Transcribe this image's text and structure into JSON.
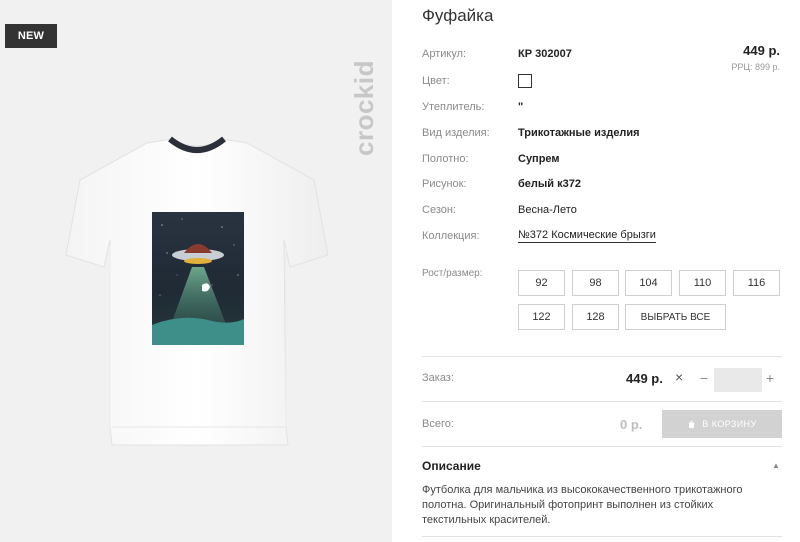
{
  "product": {
    "title": "Фуфайка",
    "badge": "NEW",
    "brand": "crockid",
    "price": "449 р.",
    "rrp": "РРЦ: 899 р."
  },
  "attributes": {
    "article_label": "Артикул:",
    "article_value": "КР 302007",
    "color_label": "Цвет:",
    "color_value": "#ffffff",
    "insulation_label": "Утеплитель:",
    "insulation_value": "\"",
    "kind_label": "Вид изделия:",
    "kind_value": "Трикотажные изделия",
    "fabric_label": "Полотно:",
    "fabric_value": "Супрем",
    "print_label": "Рисунок:",
    "print_value": "белый к372",
    "season_label": "Сезон:",
    "season_value": "Весна-Лето",
    "collection_label": "Коллекция:",
    "collection_value": "№372 Космические брызги"
  },
  "sizes": {
    "label": "Рост/размер:",
    "options": [
      "92",
      "98",
      "104",
      "110",
      "116",
      "122",
      "128"
    ],
    "select_all": "ВЫБРАТЬ ВСЕ"
  },
  "order": {
    "label": "Заказ:",
    "price": "449 р.",
    "times": "×",
    "minus": "−",
    "plus": "+",
    "quantity": ""
  },
  "total": {
    "label": "Всего:",
    "value": "0 р.",
    "cart_button": "В КОРЗИНУ"
  },
  "description": {
    "heading": "Описание",
    "toggle_icon": "chevron-up-icon",
    "text": "Футболка для мальчика из высококачественного трикотажного полотна. Оригинальный фотопринт выполнен из стойких текстильных красителей."
  },
  "colors": {
    "image_bg": "#f1f1f1",
    "badge_bg": "#333333",
    "cart_button_bg": "#d2d2d2",
    "qty_input_bg": "#e9e9e9"
  }
}
